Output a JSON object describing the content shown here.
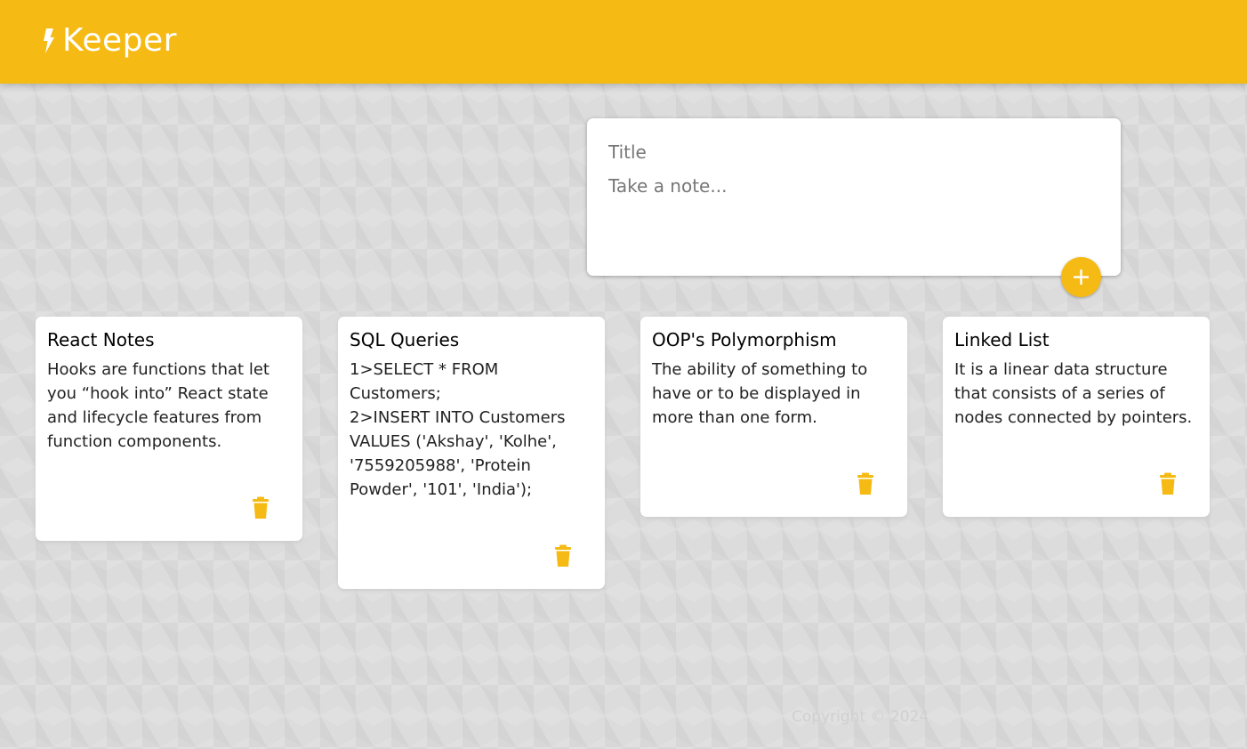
{
  "header": {
    "app_title": "Keeper",
    "logo_icon": "lightning-bolt-icon",
    "background_color": "#f5ba13"
  },
  "create_note": {
    "title_placeholder": "Title",
    "content_placeholder": "Take a note...",
    "add_icon": "plus-icon"
  },
  "notes": [
    {
      "title": "React Notes",
      "content": "Hooks are functions that let you “hook into” React state and lifecycle features from function components.",
      "delete_icon": "trash-icon"
    },
    {
      "title": "SQL Queries",
      "content": "1>SELECT * FROM Customers;\n2>INSERT INTO Customers VALUES ('Akshay', 'Kolhe', '7559205988', 'Protein Powder', '101', 'India');",
      "delete_icon": "trash-icon"
    },
    {
      "title": "OOP's Polymorphism",
      "content": "The ability of something to have or to be displayed in more than one form.",
      "delete_icon": "trash-icon"
    },
    {
      "title": "Linked List",
      "content": "It is a linear data structure that consists of a series of nodes connected by pointers.",
      "delete_icon": "trash-icon"
    }
  ],
  "footer": {
    "copyright": "Copyright © 2024"
  },
  "colors": {
    "accent": "#f5ba13",
    "card_background": "#ffffff"
  }
}
